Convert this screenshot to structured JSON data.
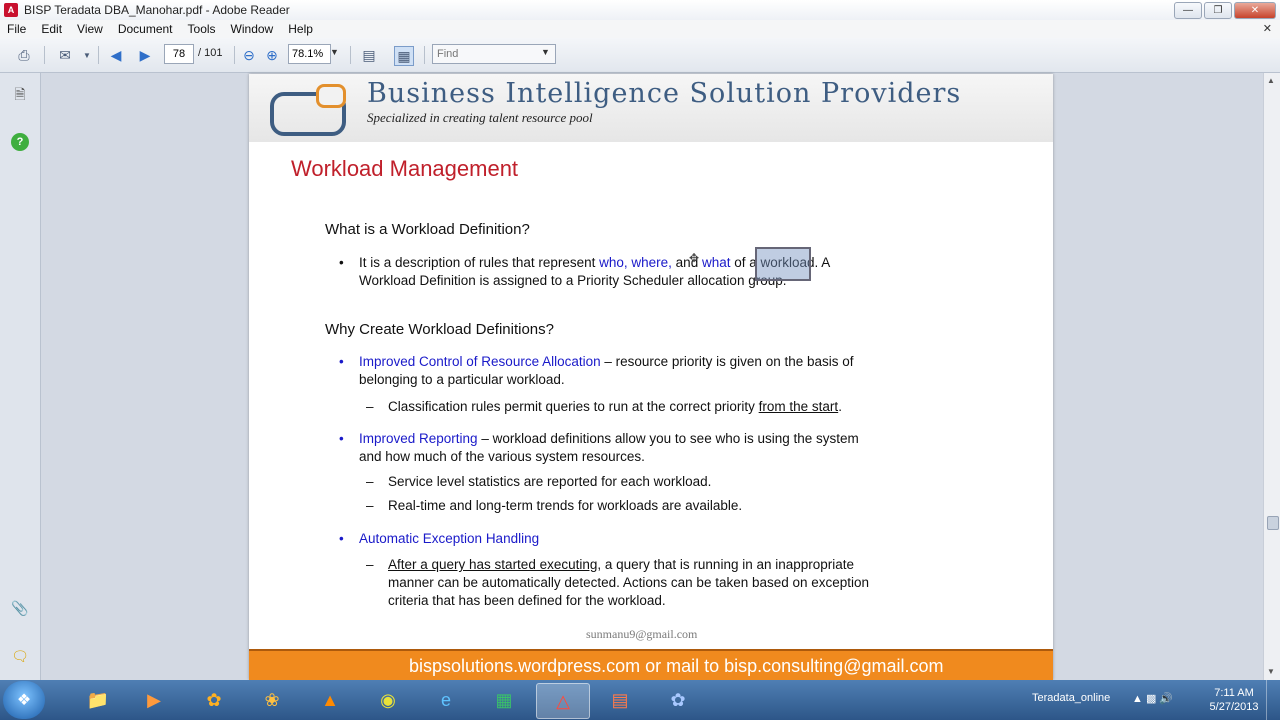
{
  "window": {
    "title": "BISP Teradata DBA_Manohar.pdf - Adobe Reader"
  },
  "menu": [
    "File",
    "Edit",
    "View",
    "Document",
    "Tools",
    "Window",
    "Help"
  ],
  "toolbar": {
    "page_current": "78",
    "page_total": "/ 101",
    "zoom": "78.1%",
    "find_placeholder": "Find"
  },
  "slide": {
    "banner_title": "Business Intelligence Solution Providers",
    "banner_subtitle": "Specialized in creating talent resource pool",
    "title": "Workload Management",
    "section1": "What is a Workload Definition?",
    "def_line1_a": "It is a description of rules that represent ",
    "def_line1_who": "who, where,",
    "def_line1_b": " and ",
    "def_line1_what": "what",
    "def_line1_c": " of a workload.  A",
    "def_line2": "Workload Definition is assigned to a Priority Scheduler allocation group.",
    "section2": "Why Create Workload Definitions?",
    "b1_blue": "Improved Control of Resource Allocation",
    "b1_rest": " – resource priority is given on the basis of",
    "b1_line2": "belonging to a particular workload.",
    "b1_sub_a": "Classification rules permit queries to run at the correct priority ",
    "b1_sub_u": "from the start",
    "b1_sub_b": ".",
    "b2_blue": "Improved Reporting",
    "b2_rest": " – workload definitions allow you to see who is using the system",
    "b2_line2": "and how much of the various system resources.",
    "b2_sub1": "Service level statistics are reported for each workload.",
    "b2_sub2": "Real-time and long-term trends for workloads are available.",
    "b3_blue": "Automatic Exception Handling",
    "b3_sub_u": "After a query has started executing",
    "b3_sub_l1": ", a query that is running in an inappropriate",
    "b3_sub_l2": "manner can be automatically detected.  Actions can be taken based on exception",
    "b3_sub_l3": "criteria that has been defined for the workload.",
    "email": "sunmanu9@gmail.com",
    "footer": "bispsolutions.wordpress.com or mail to bisp.consulting@gmail.com"
  },
  "taskbar": {
    "tray_label": "Teradata_online",
    "time": "7:11 AM",
    "date": "5/27/2013"
  }
}
